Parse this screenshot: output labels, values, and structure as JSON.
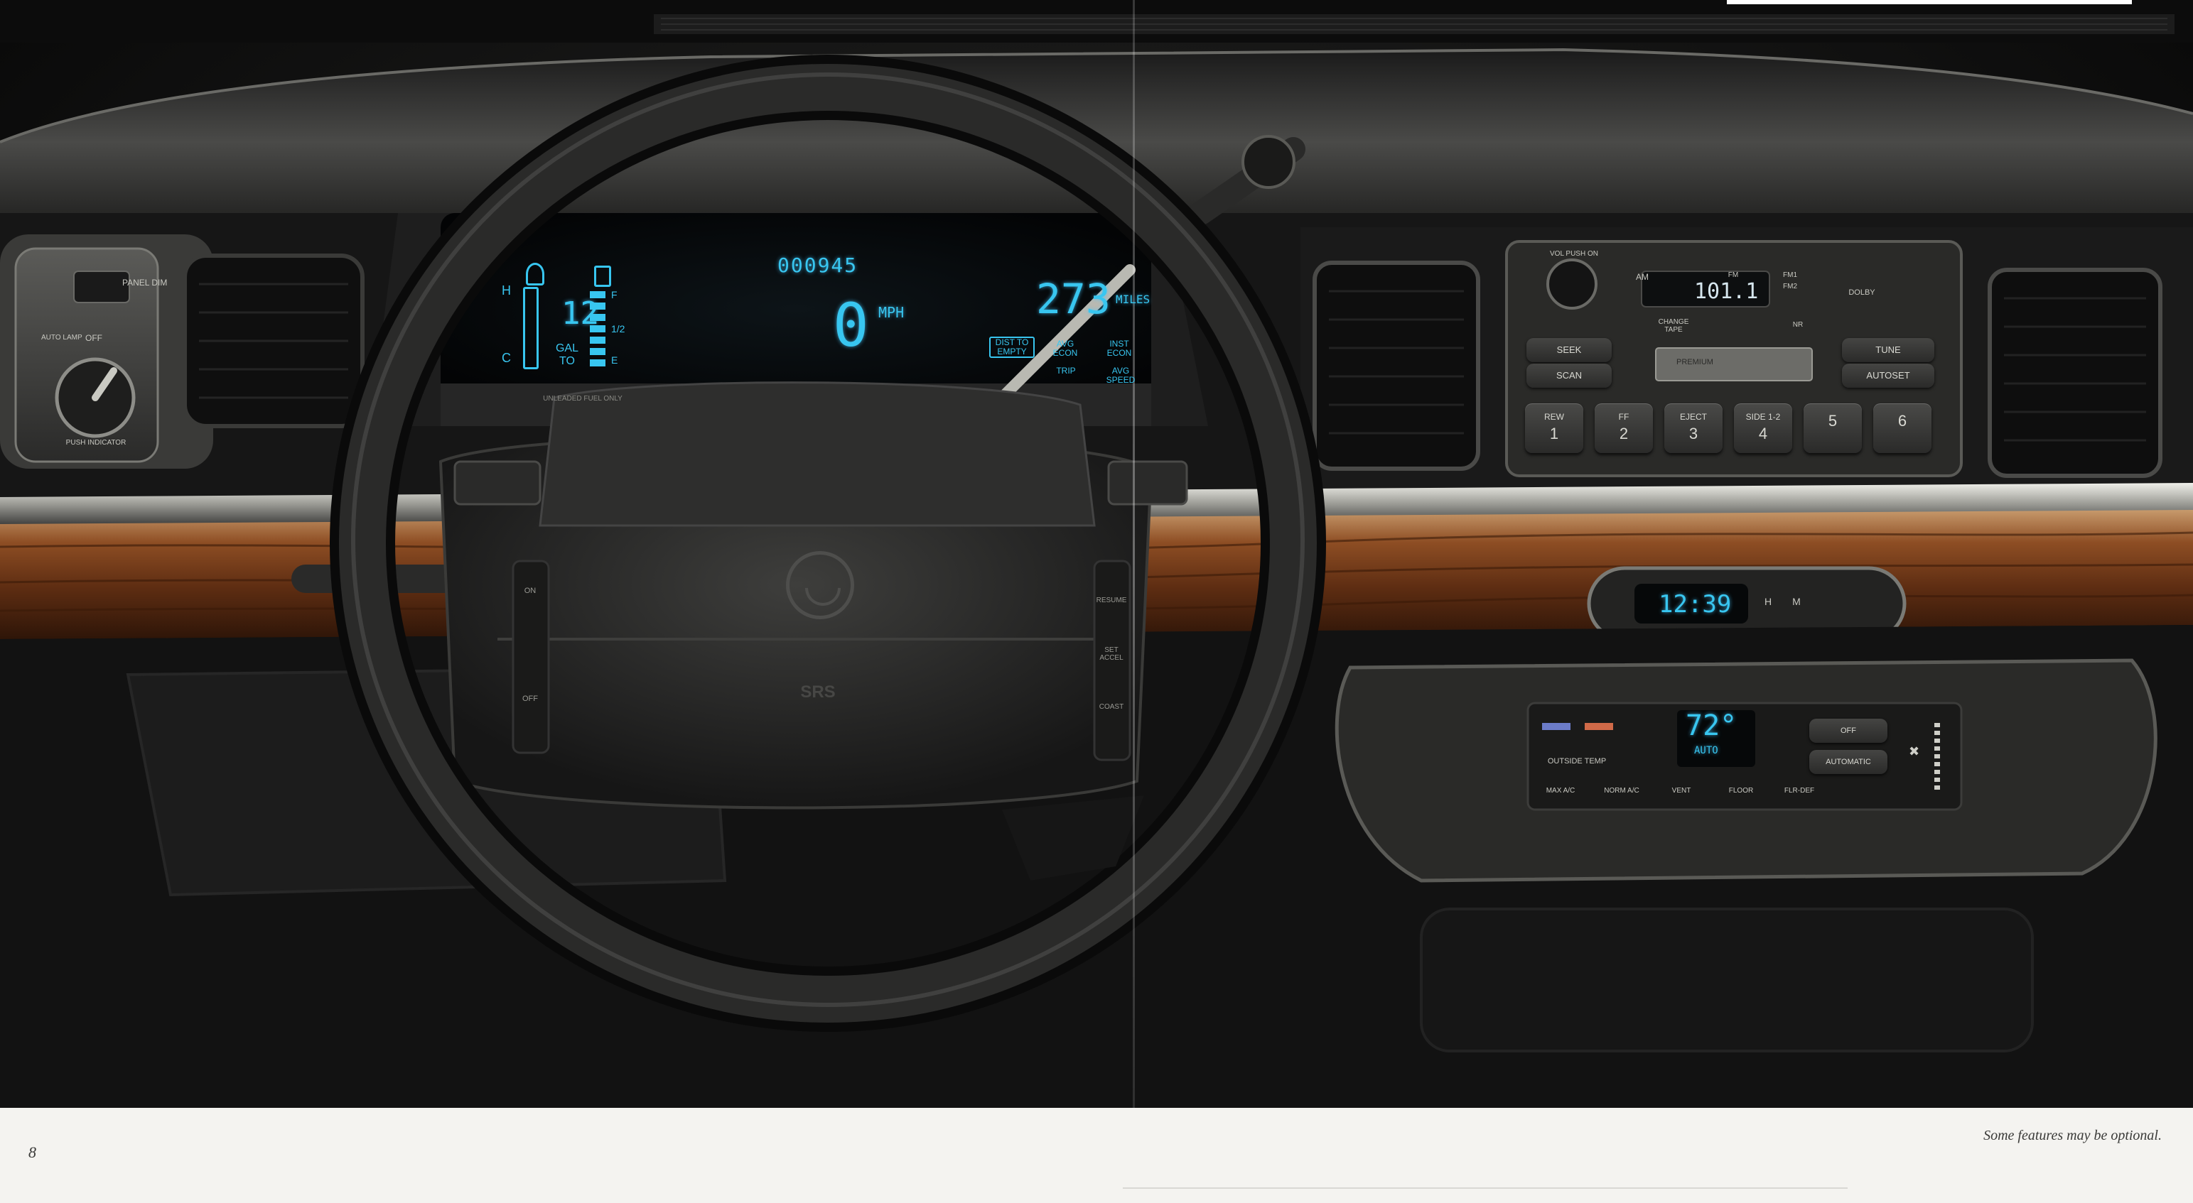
{
  "cluster": {
    "odometer": "000945",
    "speed": "0",
    "speed_unit": "MPH",
    "fuel_gallons": "12",
    "fuel_label": "GAL TO",
    "fuel_gauge_labels": [
      "F",
      "1/2",
      "E"
    ],
    "temp_labels": [
      "H",
      "C"
    ],
    "trip_miles": "273",
    "miles_unit": "MILES",
    "fuel_note": "UNLEADED FUEL ONLY",
    "buttons": [
      "DIST TO EMPTY",
      "AVG ECON",
      "INST ECON",
      "TRIP",
      "AVG SPEED"
    ]
  },
  "headlamp_panel": {
    "labels": [
      "PANEL DIM",
      "AUTO LAMP",
      "OFF",
      "PUSH INDICATOR"
    ]
  },
  "wheel": {
    "airbag_label": "SRS",
    "emblem": "mercury-emblem",
    "left_buttons": [
      "ON",
      "OFF"
    ],
    "right_buttons": [
      "RESUME",
      "SET ACCEL",
      "COAST"
    ]
  },
  "radio": {
    "vol_label": "VOL PUSH ON",
    "frequency": "101.1",
    "band_labels": [
      "AM",
      "FM",
      "FM1",
      "FM2"
    ],
    "dolby_label": "DOLBY",
    "change_tape": "CHANGE TAPE",
    "dolby_nr": "NR",
    "seek": "SEEK",
    "scan": "SCAN",
    "tune": "TUNE",
    "autoset": "AUTOSET",
    "cassette_label": "PREMIUM",
    "presets": [
      {
        "top": "REW",
        "num": "1"
      },
      {
        "top": "FF",
        "num": "2"
      },
      {
        "top": "EJECT",
        "num": "3"
      },
      {
        "top": "SIDE 1-2",
        "num": "4"
      },
      {
        "top": "",
        "num": "5"
      },
      {
        "top": "",
        "num": "6"
      }
    ]
  },
  "clock": {
    "time": "12:39",
    "h_label": "H",
    "m_label": "M"
  },
  "climate": {
    "temperature": "72°",
    "mode": "AUTO",
    "outside_temp": "OUTSIDE TEMP",
    "off": "OFF",
    "automatic": "AUTOMATIC",
    "buttons": [
      "MAX A/C",
      "NORM A/C",
      "VENT",
      "FLOOR",
      "FLR-DEF"
    ]
  },
  "footer": {
    "page_number": "8",
    "note": "Some features may be optional."
  },
  "colors": {
    "lcd": "#38c6f0",
    "wood": "#7a3f1e",
    "dash": "#2c2c2b",
    "page": "#f4f3f0"
  }
}
